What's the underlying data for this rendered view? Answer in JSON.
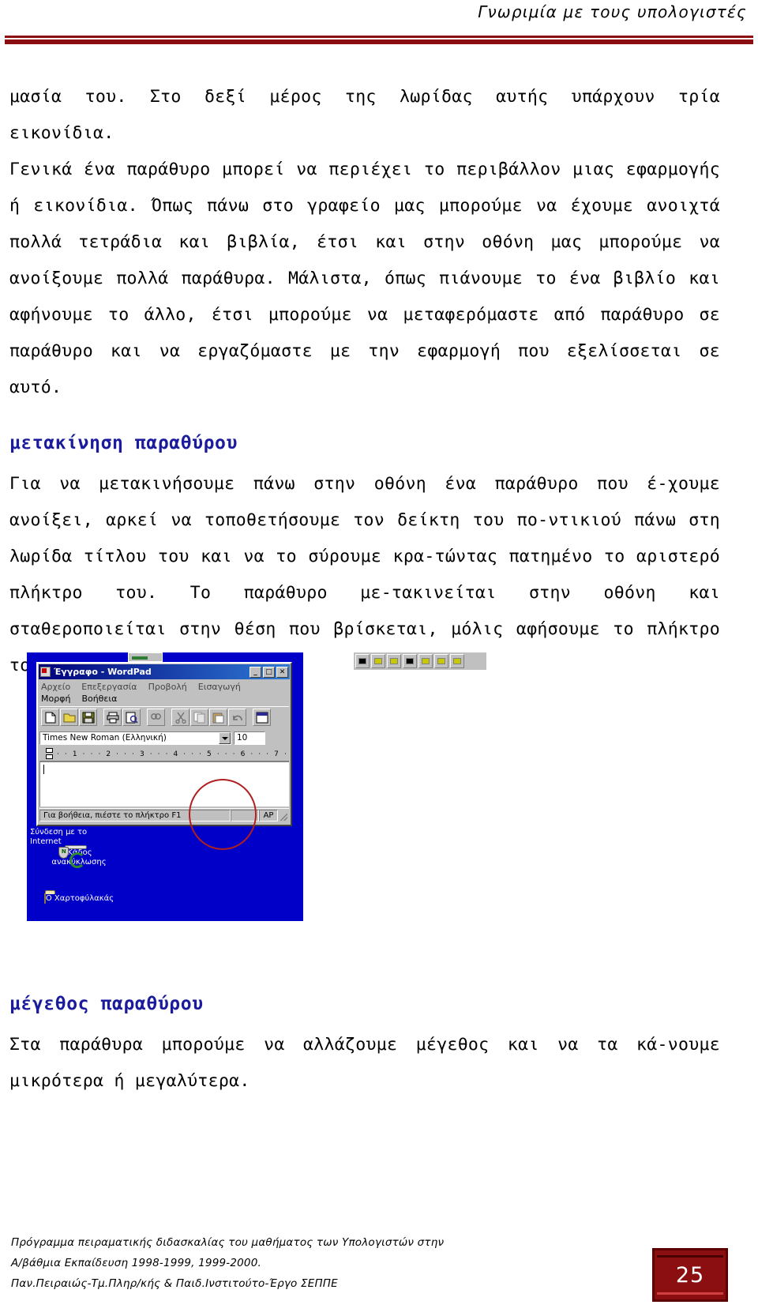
{
  "header": {
    "title": "Γνωριμία με τους υπολογιστές"
  },
  "content": {
    "paragraph_1": "μασία του. Στο δεξί μέρος της λωρίδας αυτής υπάρχουν τρία εικονίδια.",
    "paragraph_2": "Γενικά ένα παράθυρο μπορεί να περιέχει το περιβάλλον μιας εφαρμογής ή εικονίδια. Όπως πάνω στο γραφείο μας μπορούμε να έχουμε ανοιχτά πολλά τετράδια και βιβλία, έτσι και στην οθόνη μας μπορούμε να ανοίξουμε πολλά παράθυρα. Μάλιστα, όπως πιάνουμε το ένα βιβλίο και αφήνουμε το άλλο, έτσι μπορούμε να μεταφερόμαστε από παράθυρο σε παράθυρο και να εργαζόμαστε με την εφαρμογή που εξελίσσεται σε αυτό.",
    "heading_1": "μετακίνηση παραθύρου",
    "paragraph_3": "Για να μετακινήσουμε πάνω στην οθόνη ένα παράθυρο που έ-χουμε ανοίξει, αρκεί να τοποθετήσουμε τον δείκτη του πο-ντικιού πάνω στη λωρίδα τίτλου του και να το σύρουμε κρα-τώντας  πατημένο το αριστερό πλήκτρο του. Το παράθυρο με-τακινείται στην οθόνη και σταθεροποιείται στην θέση που βρίσκεται, μόλις  αφήσουμε το πλήκτρο του ποντικιού.",
    "heading_2": "μέγεθος παραθύρου",
    "paragraph_4": "Στα παράθυρα μπορούμε να αλλάζουμε μέγεθος και να τα κά-νουμε μικρότερα ή μεγαλύτερα."
  },
  "figure": {
    "wordpad": {
      "title": "Έγγραφο - WordPad",
      "window_buttons": {
        "minimize": "_",
        "maximize": "□",
        "close": "✕"
      },
      "menus_row1": [
        "Αρχείο",
        "Επεξεργασία",
        "Προβολή",
        "Εισαγωγή"
      ],
      "menus_row2": [
        "Μορφή",
        "Βοήθεια"
      ],
      "font_name": "Times New Roman (Ελληνική)",
      "font_size": "10",
      "ruler_marks": "· · 1 · · · 2 · · · 3 · · · 4 · · · 5 · · · 6 · · · 7 ·",
      "status_help": "Για βοήθεια, πιέστε το πλήκτρο F1",
      "status_caps": "AP"
    },
    "desktop_icons": [
      {
        "label": "Σύνδεση με το Internet",
        "icon": "internet-icon"
      },
      {
        "label": "Κάδος ανακύκλωσης",
        "icon": "recycle-bin-icon"
      },
      {
        "label": "Ο Χαρτοφύλακάς",
        "icon": "briefcase-folder-icon"
      }
    ],
    "annotation_color": "#b02020",
    "desktop_color": "#0000c8"
  },
  "footer": {
    "line_1": "Πρόγραμμα πειραματικής διδασκαλίας του μαθήματος των Υπολογιστών στην",
    "line_2": "Α/βάθμια Εκπαίδευση 1998-1999, 1999-2000.",
    "line_3": "Παν.Πειραιώς-Τμ.Πληρ/κής & Παιδ.Ινστιτούτο-Έργο ΣΕΠΠΕ",
    "page_number": "25"
  }
}
